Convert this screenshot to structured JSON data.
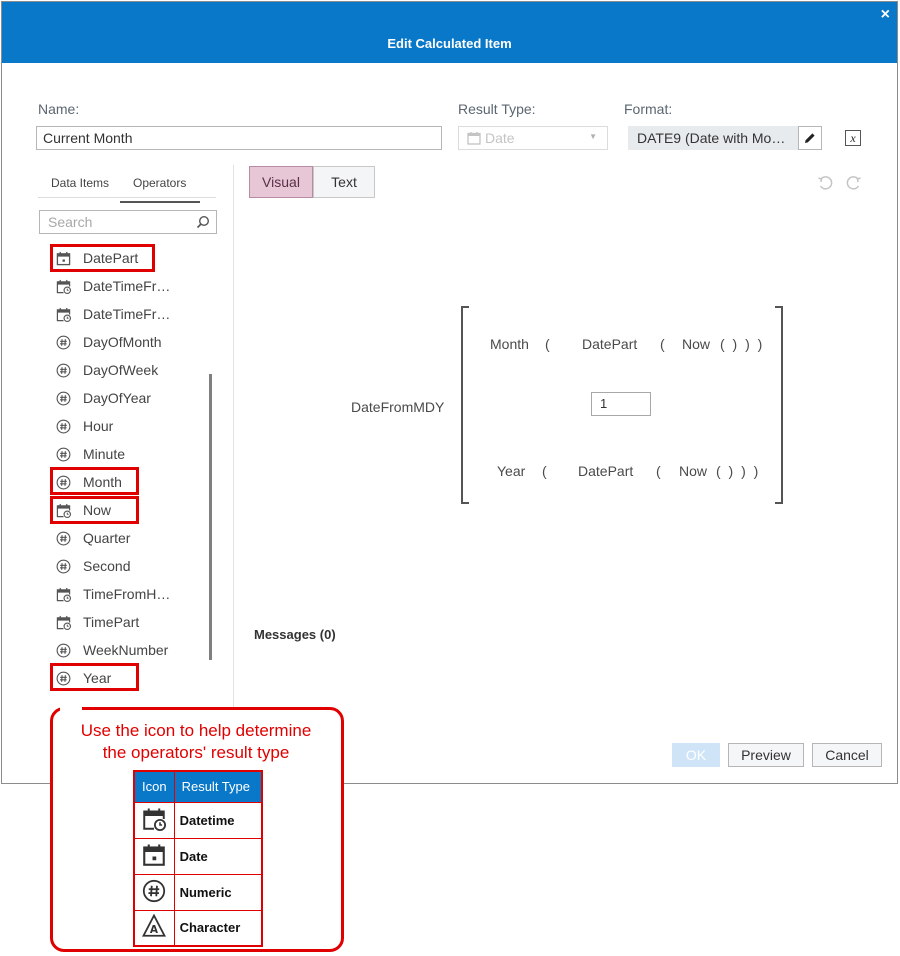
{
  "dialog": {
    "title": "Edit Calculated Item",
    "close_glyph": "×",
    "name_label": "Name:",
    "name_value": "Current Month",
    "result_type_label": "Result Type:",
    "result_type_value": "Date",
    "format_label": "Format:",
    "format_value": "DATE9 (Date with Mo…",
    "formula_icon": "x"
  },
  "left_panel": {
    "tabs": [
      {
        "label": "Data Items",
        "active": false
      },
      {
        "label": "Operators",
        "active": true
      }
    ],
    "search_placeholder": "Search",
    "operators": [
      {
        "label": "DatePart",
        "icon": "date-icon",
        "highlighted": true
      },
      {
        "label": "DateTimeFr…",
        "icon": "datetime-icon",
        "highlighted": false
      },
      {
        "label": "DateTimeFr…",
        "icon": "datetime-icon",
        "highlighted": false
      },
      {
        "label": "DayOfMonth",
        "icon": "numeric-icon",
        "highlighted": false
      },
      {
        "label": "DayOfWeek",
        "icon": "numeric-icon",
        "highlighted": false
      },
      {
        "label": "DayOfYear",
        "icon": "numeric-icon",
        "highlighted": false
      },
      {
        "label": "Hour",
        "icon": "numeric-icon",
        "highlighted": false
      },
      {
        "label": "Minute",
        "icon": "numeric-icon",
        "highlighted": false
      },
      {
        "label": "Month",
        "icon": "numeric-icon",
        "highlighted": true
      },
      {
        "label": "Now",
        "icon": "datetime-icon",
        "highlighted": true
      },
      {
        "label": "Quarter",
        "icon": "numeric-icon",
        "highlighted": false
      },
      {
        "label": "Second",
        "icon": "numeric-icon",
        "highlighted": false
      },
      {
        "label": "TimeFromH…",
        "icon": "datetime-icon",
        "highlighted": false
      },
      {
        "label": "TimePart",
        "icon": "datetime-icon",
        "highlighted": false
      },
      {
        "label": "WeekNumber",
        "icon": "numeric-icon",
        "highlighted": false
      },
      {
        "label": "Year",
        "icon": "numeric-icon",
        "highlighted": true
      }
    ]
  },
  "editor": {
    "mode_visual": "Visual",
    "mode_text": "Text",
    "active_mode": "Visual",
    "function_name": "DateFromMDY",
    "row1": {
      "fn": "Month",
      "open": "(",
      "inner": "DatePart",
      "open2": "(",
      "now": "Now",
      "close": "( ) ) )"
    },
    "day_value": "1",
    "row3": {
      "fn": "Year",
      "open": "(",
      "inner": "DatePart",
      "open2": "(",
      "now": "Now",
      "close": "( ) ) )"
    },
    "messages_label": "Messages (0)"
  },
  "buttons": {
    "ok": "OK",
    "preview": "Preview",
    "cancel": "Cancel"
  },
  "callout": {
    "line1": "Use the icon to help determine",
    "line2": "the operators' result type",
    "header_icon": "Icon",
    "header_type": "Result Type",
    "rows": [
      {
        "icon": "datetime-icon",
        "type": "Datetime"
      },
      {
        "icon": "date-icon",
        "type": "Date"
      },
      {
        "icon": "numeric-icon",
        "type": "Numeric"
      },
      {
        "icon": "character-icon",
        "type": "Character"
      }
    ]
  },
  "colors": {
    "title_bar": "#0a78c8",
    "highlight": "#e10000",
    "visual_tab": "#e7c6d6"
  }
}
